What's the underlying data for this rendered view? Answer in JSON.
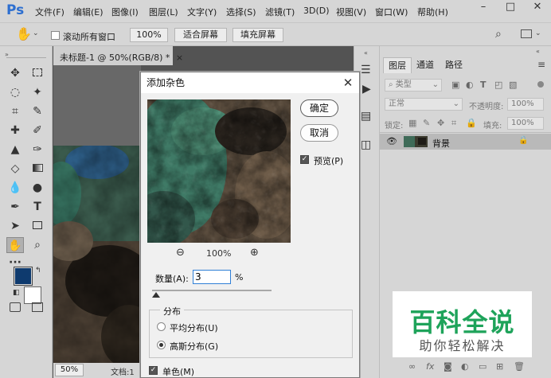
{
  "app": {
    "logo": "Ps",
    "menu": [
      "文件(F)",
      "编辑(E)",
      "图像(I)",
      "图层(L)",
      "文字(Y)",
      "选择(S)",
      "滤镜(T)",
      "3D(D)",
      "视图(V)",
      "窗口(W)",
      "帮助(H)"
    ],
    "window_controls": [
      "–",
      "□",
      "✕"
    ]
  },
  "options_bar": {
    "scroll_all_label": "滚动所有窗口",
    "zoom_value": "100%",
    "fit_screen": "适合屏幕",
    "fill_screen": "填充屏幕"
  },
  "document": {
    "tab_title": "未标题-1 @ 50%(RGB/8) *",
    "tab_close": "×",
    "zoom": "50%",
    "doc_label": "文档:1"
  },
  "layers_panel": {
    "tabs": [
      "图层",
      "通道",
      "路径"
    ],
    "kind_filter": "类型",
    "blend_mode": "正常",
    "opacity_label": "不透明度:",
    "opacity_value": "100%",
    "lock_label": "锁定:",
    "fill_label": "填充:",
    "fill_value": "100%",
    "layers": [
      {
        "name": "背景"
      }
    ]
  },
  "dialog": {
    "title": "添加杂色",
    "close": "✕",
    "ok_button": "确定",
    "cancel_button": "取消",
    "preview_label": "预览(P)",
    "preview_zoom": "100%",
    "amount_label": "数量(A):",
    "amount_value": "3",
    "amount_unit": "%",
    "distribution_label": "分布",
    "uniform_label": "平均分布(U)",
    "gaussian_label": "高斯分布(G)",
    "monochromatic_label": "单色(M)",
    "selected_distribution": "gaussian",
    "monochromatic_checked": true,
    "preview_checked": true
  },
  "watermark": {
    "title": "百科全说",
    "subtitle": "助你轻松解决"
  },
  "colors": {
    "foreground": "#0e3a6e",
    "background": "#ffffff",
    "accent": "#2f7fd6",
    "brand_green": "#1ea35a"
  }
}
